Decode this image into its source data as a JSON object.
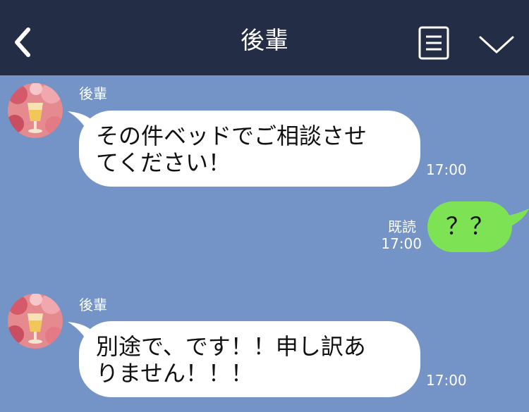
{
  "header": {
    "title": "後輩",
    "back_icon": "chevron-left-icon",
    "menu_icon": "notes-menu-icon",
    "collapse_icon": "chevron-down-icon",
    "background_color": "#232d45"
  },
  "chat": {
    "background_color": "#7493c6",
    "messages": [
      {
        "sender": "後輩",
        "text_line1": "その件ベッドでご相談させ",
        "text_line2": "てください！",
        "time": "17:00"
      },
      {
        "sender": "me",
        "text": "？？",
        "read_status": "既読",
        "time": "17:00",
        "bubble_color": "#7de354"
      },
      {
        "sender": "後輩",
        "text_line1": "別途で、です！！申し訳あ",
        "text_line2": "りません！！！",
        "time": "17:00"
      }
    ]
  }
}
